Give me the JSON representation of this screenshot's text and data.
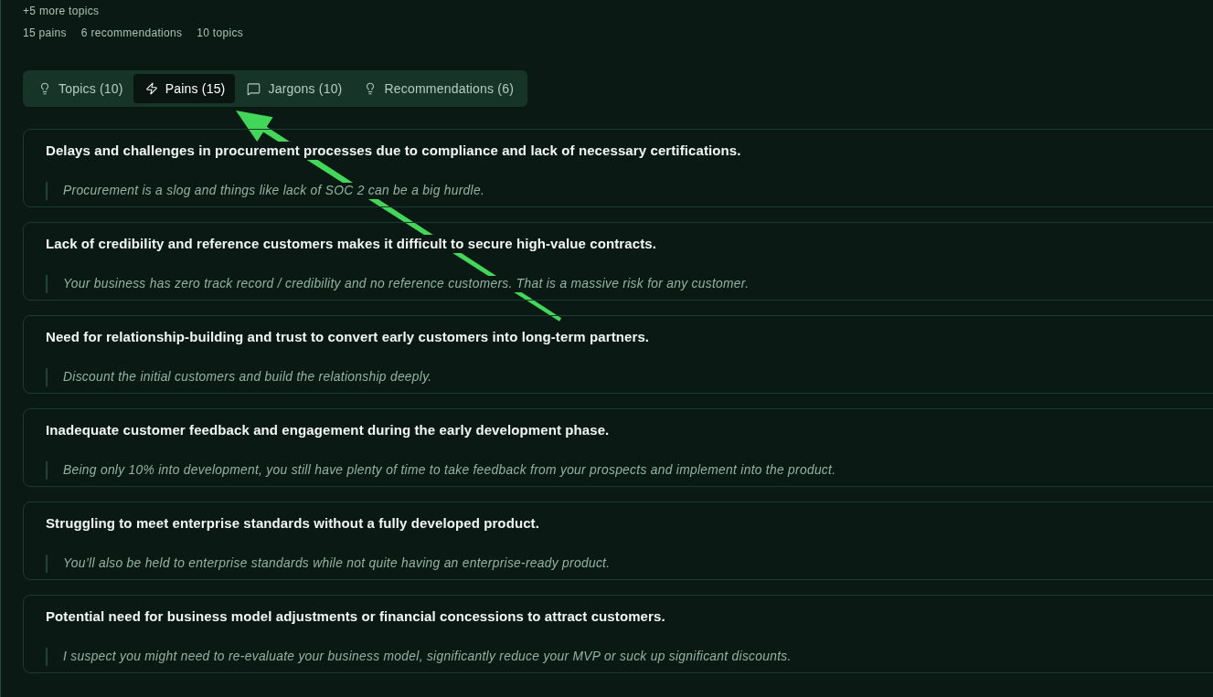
{
  "summary": {
    "more_topics": "+5 more topics",
    "counts": [
      "15 pains",
      "6 recommendations",
      "10 topics"
    ]
  },
  "tabs": [
    {
      "label": "Topics (10)",
      "kind": "topic",
      "selected": false
    },
    {
      "label": "Pains (15)",
      "kind": "pain",
      "selected": true
    },
    {
      "label": "Jargons (10)",
      "kind": "jargon",
      "selected": false
    },
    {
      "label": "Recommendations (6)",
      "kind": "recommendation",
      "selected": false
    }
  ],
  "pains": [
    {
      "title": "Delays and challenges in procurement processes due to compliance and lack of necessary certifications.",
      "quote": "Procurement is a slog and things like lack of SOC 2 can be a big hurdle."
    },
    {
      "title": "Lack of credibility and reference customers makes it difficult to secure high-value contracts.",
      "quote": "Your business has zero track record / credibility and no reference customers. That is a massive risk for any customer."
    },
    {
      "title": "Need for relationship-building and trust to convert early customers into long-term partners.",
      "quote": "Discount the initial customers and build the relationship deeply."
    },
    {
      "title": "Inadequate customer feedback and engagement during the early development phase.",
      "quote": "Being only 10% into development, you still have plenty of time to take feedback from your prospects and implement into the product."
    },
    {
      "title": "Struggling to meet enterprise standards without a fully developed product.",
      "quote": "You’ll also be held to enterprise standards while not quite having an enterprise-ready product."
    },
    {
      "title": "Potential need for business model adjustments or financial concessions to attract customers.",
      "quote": "I suspect you might need to re-evaluate your business model, significantly reduce your MVP or suck up significant discounts."
    }
  ]
}
